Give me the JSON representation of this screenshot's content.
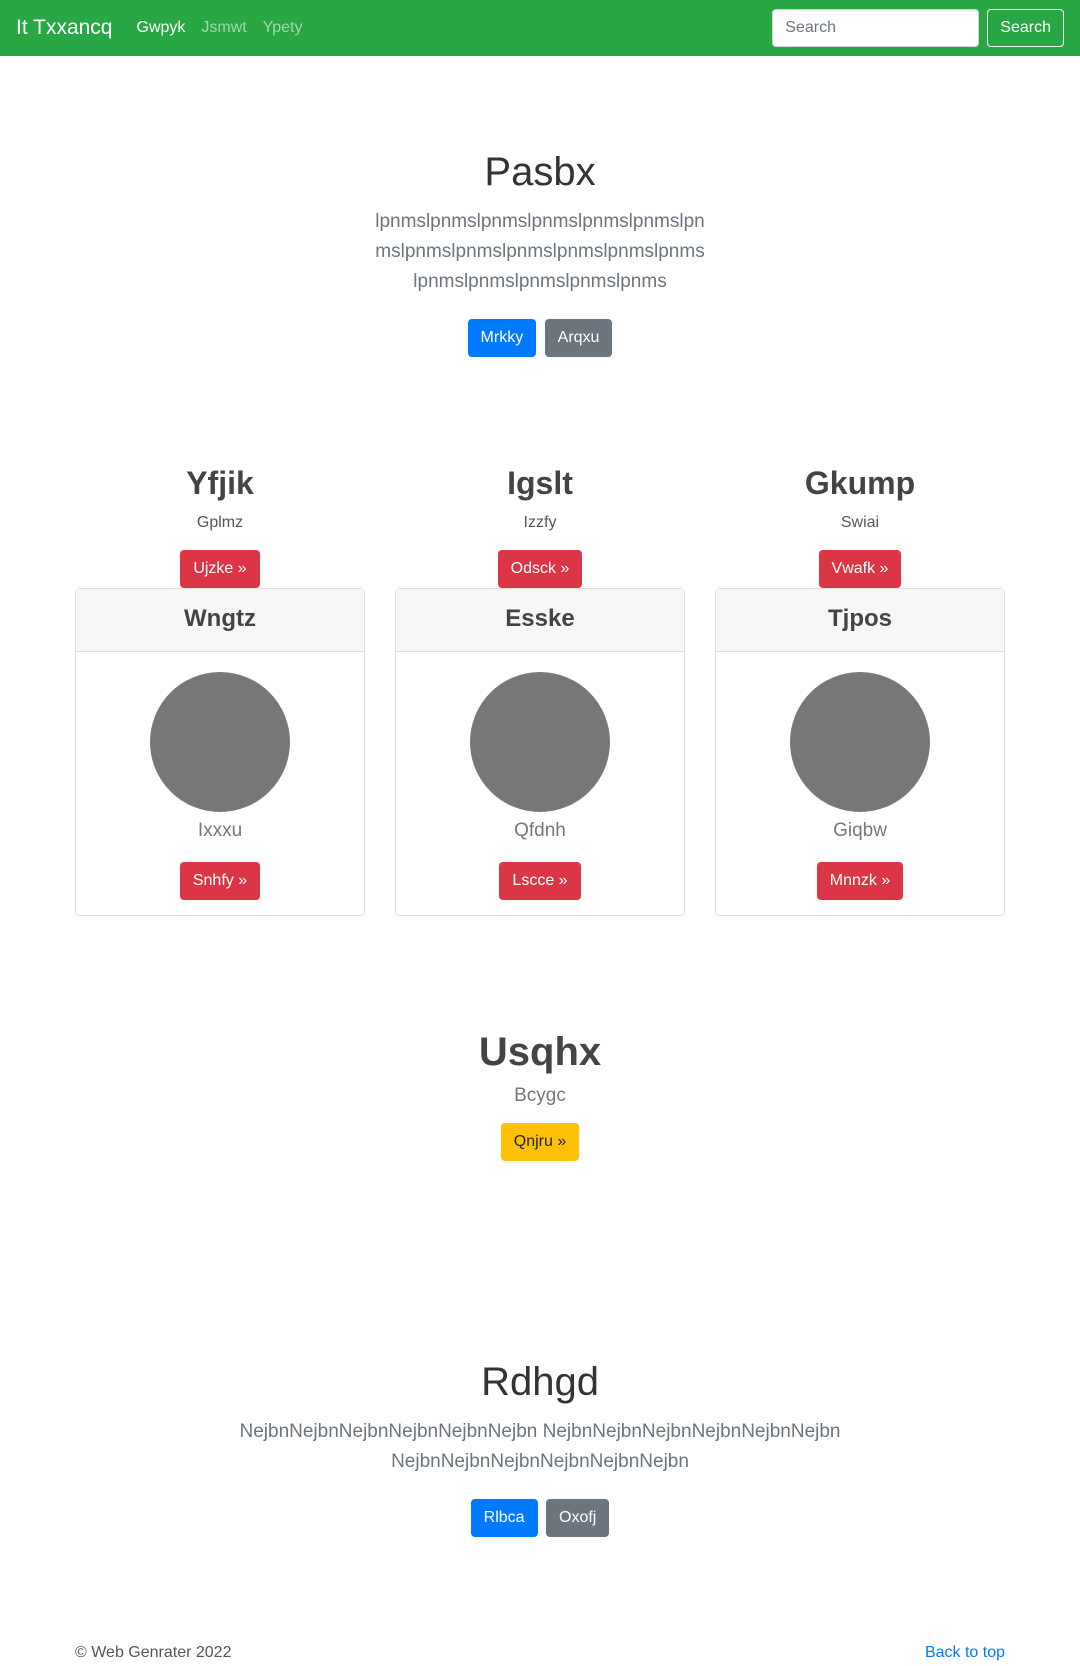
{
  "navbar": {
    "brand": "It Txxancq",
    "links": [
      "Gwpyk",
      "Jsmwt",
      "Ypety"
    ],
    "search_placeholder": "Search",
    "search_button": "Search"
  },
  "hero1": {
    "title": "Pasbx",
    "lead": "lpnmslpnmslpnmslpnmslpnmslpnmslpnmslpnmslpnmslpnmslpnmslpnmslpnmslpnmslpnmslpnmslpnmslpnms",
    "primary_button": "Mrkky",
    "secondary_button": "Arqxu"
  },
  "columns": [
    {
      "title": "Yfjik",
      "subtitle": "Gplmz",
      "button": "Ujzke »"
    },
    {
      "title": "Igslt",
      "subtitle": "Izzfy",
      "button": "Odsck »"
    },
    {
      "title": "Gkump",
      "subtitle": "Swiai",
      "button": "Vwafk »"
    }
  ],
  "cards": [
    {
      "header": "Wngtz",
      "text": "Ixxxu",
      "button": "Snhfy »"
    },
    {
      "header": "Esske",
      "text": "Qfdnh",
      "button": "Lscce »"
    },
    {
      "header": "Tjpos",
      "text": "Giqbw",
      "button": "Mnnzk »"
    }
  ],
  "feature": {
    "title": "Usqhx",
    "subtitle": "Bcygc",
    "button": "Qnjru »"
  },
  "hero2": {
    "title": "Rdhgd",
    "lead": "NejbnNejbnNejbnNejbnNejbnNejbn NejbnNejbnNejbnNejbnNejbnNejbn NejbnNejbnNejbnNejbnNejbnNejbn",
    "primary_button": "Rlbca",
    "secondary_button": "Oxofj"
  },
  "footer": {
    "copyright": "© Web Genrater 2022",
    "back_to_top": "Back to top"
  },
  "colors": {
    "navbar": "#28a745",
    "primary": "#007bff",
    "secondary": "#6c757d",
    "danger": "#dc3545",
    "warning": "#ffc107",
    "avatar": "#777777"
  }
}
